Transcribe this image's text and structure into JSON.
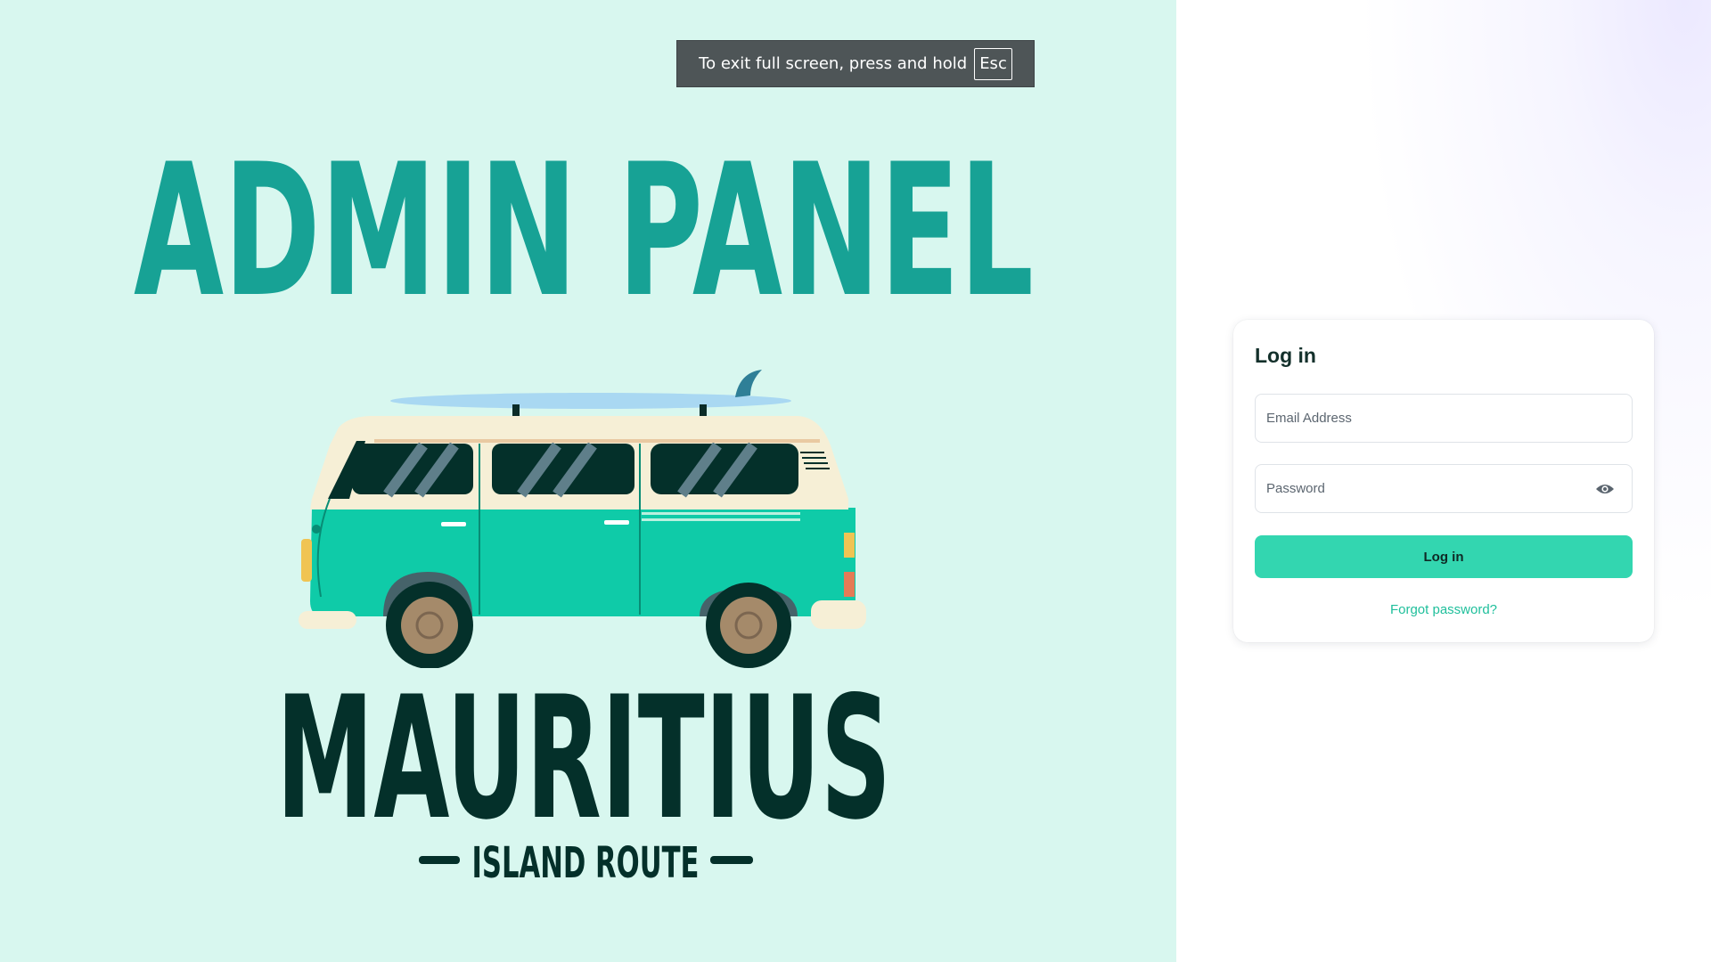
{
  "fullscreen_toast": {
    "message": "To exit full screen, press and hold",
    "key": "Esc"
  },
  "hero": {
    "title": "ADMIN PANEL",
    "brand": "MAURITIUS",
    "tagline": "ISLAND ROUTE",
    "illustration": "camper-van-with-surfboard"
  },
  "login": {
    "title": "Log in",
    "email_placeholder": "Email Address",
    "email_value": "",
    "password_placeholder": "Password",
    "password_value": "",
    "password_toggle_icon": "eye-icon",
    "submit_label": "Log in",
    "forgot_label": "Forgot password?"
  },
  "colors": {
    "left_background": "#d8f7ef",
    "title_teal": "#17a295",
    "brand_dark": "#04302a",
    "accent": "#33d6b0",
    "link": "#1fbf9b"
  }
}
